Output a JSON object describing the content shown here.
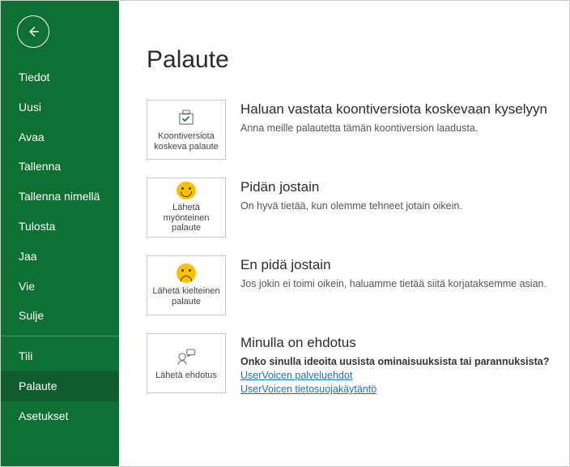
{
  "sidebar": {
    "items": [
      {
        "label": "Tiedot"
      },
      {
        "label": "Uusi"
      },
      {
        "label": "Avaa"
      },
      {
        "label": "Tallenna"
      },
      {
        "label": "Tallenna nimellä"
      },
      {
        "label": "Tulosta"
      },
      {
        "label": "Jaa"
      },
      {
        "label": "Vie"
      },
      {
        "label": "Sulje"
      },
      {
        "label": "Tili"
      },
      {
        "label": "Palaute"
      },
      {
        "label": "Asetukset"
      }
    ],
    "selected_index": 10
  },
  "page": {
    "title": "Palaute",
    "options": [
      {
        "tile_label": "Koontiversiota koskeva palaute",
        "title": "Haluan vastata koontiversiota koskevaan kyselyyn",
        "desc": "Anna meille palautetta tämän koontiversion laadusta."
      },
      {
        "tile_label": "Lähetä myönteinen palaute",
        "title": "Pidän jostain",
        "desc": "On hyvä tietää, kun olemme tehneet jotain oikein."
      },
      {
        "tile_label": "Lähetä kielteinen palaute",
        "title": "En pidä jostain",
        "desc": "Jos jokin ei toimi oikein, haluamme tietää siitä korjataksemme asian."
      },
      {
        "tile_label": "Lähetä ehdotus",
        "title": "Minulla on ehdotus",
        "desc": "Onko sinulla ideoita uusista ominaisuuksista tai parannuksista?",
        "links": [
          "UserVoicen palveluehdot",
          "UserVoicen tietosuojakäytäntö"
        ]
      }
    ]
  }
}
